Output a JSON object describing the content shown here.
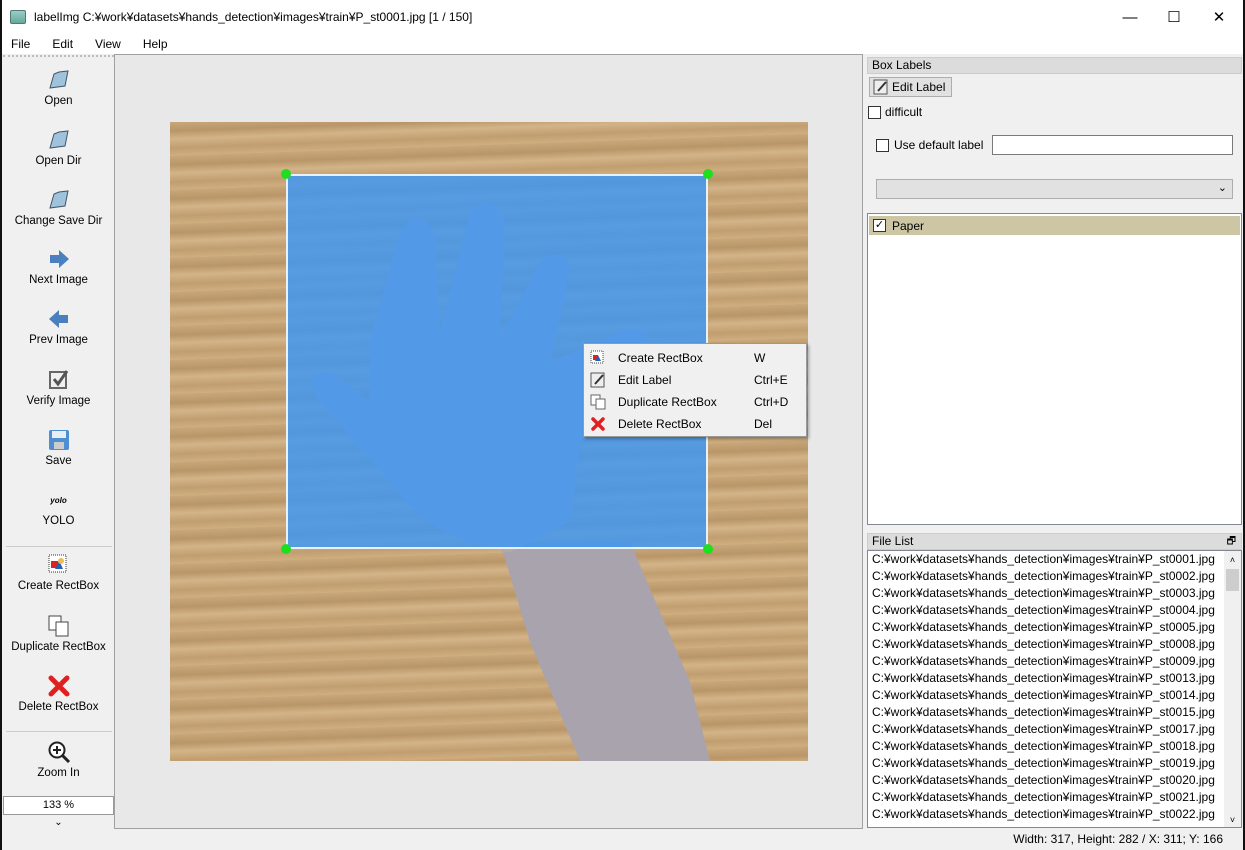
{
  "window": {
    "title": "labelImg C:¥work¥datasets¥hands_detection¥images¥train¥P_st0001.jpg [1 / 150]",
    "minimize": "—",
    "maximize": "☐",
    "close": "✕"
  },
  "menu": [
    "File",
    "Edit",
    "View",
    "Help"
  ],
  "toolbar": {
    "items": [
      {
        "label": "Open",
        "icon": "folder-icon"
      },
      {
        "label": "Open Dir",
        "icon": "folder-icon"
      },
      {
        "label": "Change Save Dir",
        "icon": "folder-icon"
      },
      {
        "label": "Next Image",
        "icon": "arrow-right-icon"
      },
      {
        "label": "Prev Image",
        "icon": "arrow-left-icon"
      },
      {
        "label": "Verify Image",
        "icon": "checkbox-icon"
      },
      {
        "label": "Save",
        "icon": "floppy-icon"
      },
      {
        "label": "YOLO",
        "icon": "yolo-icon",
        "icon_text": "yolo"
      },
      {
        "label": "Create RectBox",
        "icon": "create-rectbox-icon"
      },
      {
        "label": "Duplicate RectBox",
        "icon": "duplicate-icon"
      },
      {
        "label": "Delete RectBox",
        "icon": "delete-x-icon"
      },
      {
        "label": "Zoom In",
        "icon": "zoom-in-icon"
      }
    ],
    "zoom_value": "133 %",
    "more": "⌄"
  },
  "context_menu": [
    {
      "label": "Create RectBox",
      "shortcut": "W"
    },
    {
      "label": "Edit Label",
      "shortcut": "Ctrl+E"
    },
    {
      "label": "Duplicate RectBox",
      "shortcut": "Ctrl+D"
    },
    {
      "label": "Delete RectBox",
      "shortcut": "Del"
    }
  ],
  "box_labels": {
    "title": "Box Labels",
    "edit_label": "Edit Label",
    "difficult": "difficult",
    "difficult_checked": false,
    "use_default_label": "Use default label",
    "use_default_checked": false,
    "default_label_value": "",
    "dropdown_value": "",
    "labels": [
      {
        "name": "Paper",
        "checked": true
      }
    ]
  },
  "file_list": {
    "title": "File List",
    "files": [
      "C:¥work¥datasets¥hands_detection¥images¥train¥P_st0001.jpg",
      "C:¥work¥datasets¥hands_detection¥images¥train¥P_st0002.jpg",
      "C:¥work¥datasets¥hands_detection¥images¥train¥P_st0003.jpg",
      "C:¥work¥datasets¥hands_detection¥images¥train¥P_st0004.jpg",
      "C:¥work¥datasets¥hands_detection¥images¥train¥P_st0005.jpg",
      "C:¥work¥datasets¥hands_detection¥images¥train¥P_st0008.jpg",
      "C:¥work¥datasets¥hands_detection¥images¥train¥P_st0009.jpg",
      "C:¥work¥datasets¥hands_detection¥images¥train¥P_st0013.jpg",
      "C:¥work¥datasets¥hands_detection¥images¥train¥P_st0014.jpg",
      "C:¥work¥datasets¥hands_detection¥images¥train¥P_st0015.jpg",
      "C:¥work¥datasets¥hands_detection¥images¥train¥P_st0017.jpg",
      "C:¥work¥datasets¥hands_detection¥images¥train¥P_st0018.jpg",
      "C:¥work¥datasets¥hands_detection¥images¥train¥P_st0019.jpg",
      "C:¥work¥datasets¥hands_detection¥images¥train¥P_st0020.jpg",
      "C:¥work¥datasets¥hands_detection¥images¥train¥P_st0021.jpg",
      "C:¥work¥datasets¥hands_detection¥images¥train¥P_st0022.jpg"
    ]
  },
  "status": "Width: 317, Height: 282 / X: 311; Y: 166",
  "colors": {
    "bbox_fill": "#3c96f5",
    "handle": "#1ede1e",
    "label_selected": "#cdc6a5"
  }
}
